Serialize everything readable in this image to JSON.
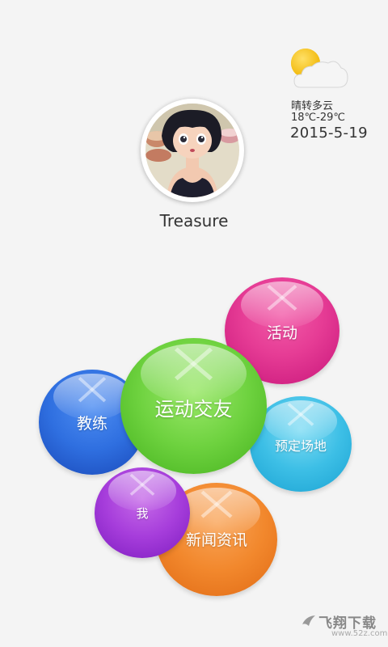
{
  "weather": {
    "icon": "partly-cloudy-icon",
    "description": "晴转多云",
    "temperature": "18℃-29℃",
    "date": "2015-5-19"
  },
  "profile": {
    "username": "Treasure"
  },
  "menu": {
    "activity": "活动",
    "coach": "教练",
    "main": "运动交友",
    "booking": "预定场地",
    "me": "我",
    "news": "新闻资讯"
  },
  "watermark": {
    "title": "飞翔下载",
    "url": "www.52z.com"
  },
  "colors": {
    "activity": "#e63c95",
    "coach": "#2f6fe0",
    "main": "#6ed23f",
    "booking": "#3dbfe6",
    "me": "#a63ddb",
    "news": "#f2882d"
  }
}
